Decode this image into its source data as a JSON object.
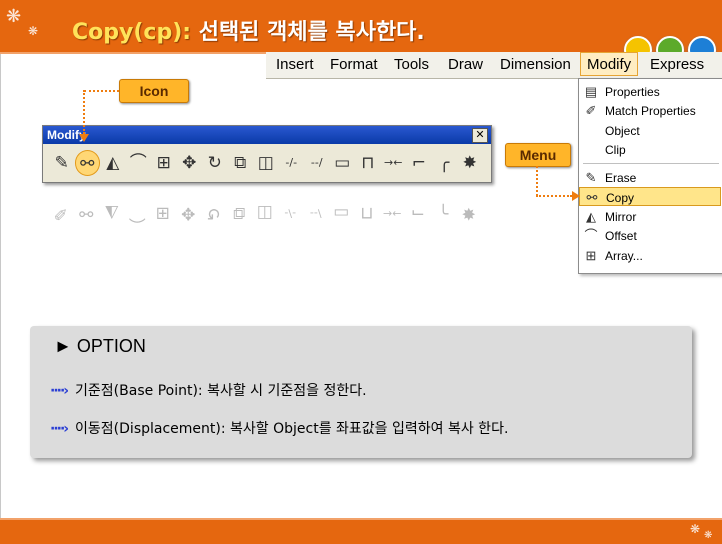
{
  "slide": {
    "title_prefix": "Copy(cp):",
    "title_text": " 선택된 객체를 복사한다."
  },
  "colors": {
    "accent": "#e5670f",
    "callout": "#ffb529",
    "highlight": "#ffe58a",
    "bullet_arrow": "#2b3fd4"
  },
  "menubar": {
    "items": [
      {
        "label": "Insert"
      },
      {
        "label": "Format"
      },
      {
        "label": "Tools"
      },
      {
        "label": "Draw"
      },
      {
        "label": "Dimension"
      },
      {
        "label": "Modify"
      },
      {
        "label": "Express"
      }
    ]
  },
  "dropdown": {
    "items": [
      {
        "icon": "properties-icon",
        "label": "Properties"
      },
      {
        "icon": "match-properties-icon",
        "label": "Match Properties"
      },
      {
        "icon": "",
        "label": "Object"
      },
      {
        "icon": "",
        "label": "Clip"
      },
      {
        "icon": "erase-icon",
        "label": "Erase"
      },
      {
        "icon": "copy-icon",
        "label": "Copy"
      },
      {
        "icon": "mirror-icon",
        "label": "Mirror"
      },
      {
        "icon": "offset-icon",
        "label": "Offset"
      },
      {
        "icon": "array-icon",
        "label": "Array..."
      }
    ]
  },
  "toolbar": {
    "title": "Modify",
    "close_label": "✕",
    "icons": [
      {
        "name": "erase-icon",
        "glyph": "✎"
      },
      {
        "name": "copy-icon",
        "glyph": "⚯"
      },
      {
        "name": "mirror-icon",
        "glyph": "◭"
      },
      {
        "name": "offset-icon",
        "glyph": "⌒"
      },
      {
        "name": "array-icon",
        "glyph": "⊞"
      },
      {
        "name": "move-icon",
        "glyph": "✥"
      },
      {
        "name": "rotate-icon",
        "glyph": "↻"
      },
      {
        "name": "scale-icon",
        "glyph": "⧉"
      },
      {
        "name": "stretch-icon",
        "glyph": "◫"
      },
      {
        "name": "trim-icon",
        "glyph": "-/-"
      },
      {
        "name": "extend-icon",
        "glyph": "--/"
      },
      {
        "name": "break-at-point-icon",
        "glyph": "▭"
      },
      {
        "name": "break-icon",
        "glyph": "⊓"
      },
      {
        "name": "join-icon",
        "glyph": "→←"
      },
      {
        "name": "chamfer-icon",
        "glyph": "⌐"
      },
      {
        "name": "fillet-icon",
        "glyph": "╭"
      },
      {
        "name": "explode-icon",
        "glyph": "✸"
      }
    ]
  },
  "callouts": {
    "icon_label": "Icon",
    "menu_label": "Menu"
  },
  "option": {
    "title": "► OPTION",
    "bullet": "····›",
    "items": [
      {
        "text": "기준점(Base Point): 복사할 시 기준점을 정한다."
      },
      {
        "text": "이동점(Displacement): 복사할 Object를 좌표값을 입력하여 복사 한다."
      }
    ]
  }
}
